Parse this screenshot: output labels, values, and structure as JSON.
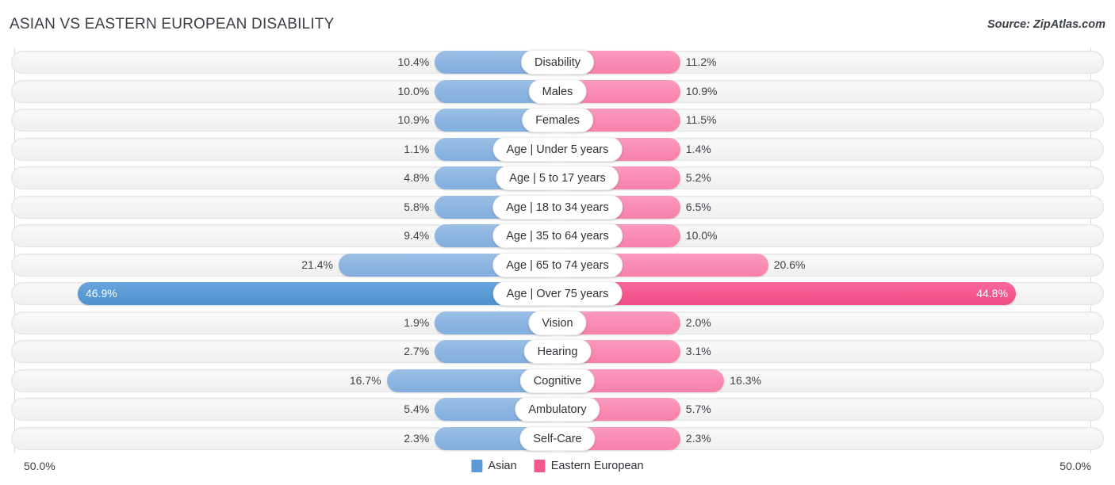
{
  "header": {
    "title": "ASIAN VS EASTERN EUROPEAN DISABILITY",
    "source": "Source: ZipAtlas.com"
  },
  "axis": {
    "left_label": "50.0%",
    "right_label": "50.0%",
    "max": 50.0
  },
  "legend": {
    "items": [
      {
        "label": "Asian",
        "color": "#5b9bd5"
      },
      {
        "label": "Eastern European",
        "color": "#f4588f"
      }
    ]
  },
  "colors": {
    "asian": "#8db5e1",
    "asian_highlight": "#5b9bd5",
    "eastern_european": "#f98cb4",
    "eastern_european_highlight": "#f4588f",
    "track": "#f4f4f4",
    "gridline": "#d9dbde",
    "text": "#3d4248"
  },
  "chart_data": {
    "type": "bar",
    "title": "ASIAN VS EASTERN EUROPEAN DISABILITY",
    "subtitle": "Source: ZipAtlas.com",
    "orientation": "horizontal-diverging",
    "xlabel": "",
    "ylabel": "",
    "xlim": [
      50.0,
      50.0
    ],
    "grid": true,
    "legend_position": "bottom-center",
    "categories": [
      "Disability",
      "Males",
      "Females",
      "Age | Under 5 years",
      "Age | 5 to 17 years",
      "Age | 18 to 34 years",
      "Age | 35 to 64 years",
      "Age | 65 to 74 years",
      "Age | Over 75 years",
      "Vision",
      "Hearing",
      "Cognitive",
      "Ambulatory",
      "Self-Care"
    ],
    "series": [
      {
        "name": "Asian",
        "color": "#8db5e1",
        "values": [
          10.4,
          10.0,
          10.9,
          1.1,
          4.8,
          5.8,
          9.4,
          21.4,
          46.9,
          1.9,
          2.7,
          16.7,
          5.4,
          2.3
        ]
      },
      {
        "name": "Eastern European",
        "color": "#f98cb4",
        "values": [
          11.2,
          10.9,
          11.5,
          1.4,
          5.2,
          6.5,
          10.0,
          20.6,
          44.8,
          2.0,
          3.1,
          16.3,
          5.7,
          2.3
        ]
      }
    ],
    "value_labels": {
      "Asian": [
        "10.4%",
        "10.0%",
        "10.9%",
        "1.1%",
        "4.8%",
        "5.8%",
        "9.4%",
        "21.4%",
        "46.9%",
        "1.9%",
        "2.7%",
        "16.7%",
        "5.4%",
        "2.3%"
      ],
      "Eastern European": [
        "11.2%",
        "10.9%",
        "11.5%",
        "1.4%",
        "5.2%",
        "6.5%",
        "10.0%",
        "20.6%",
        "44.8%",
        "2.0%",
        "3.1%",
        "16.3%",
        "5.7%",
        "2.3%"
      ]
    },
    "highlighted_rows": [
      "Age | Over 75 years"
    ]
  }
}
